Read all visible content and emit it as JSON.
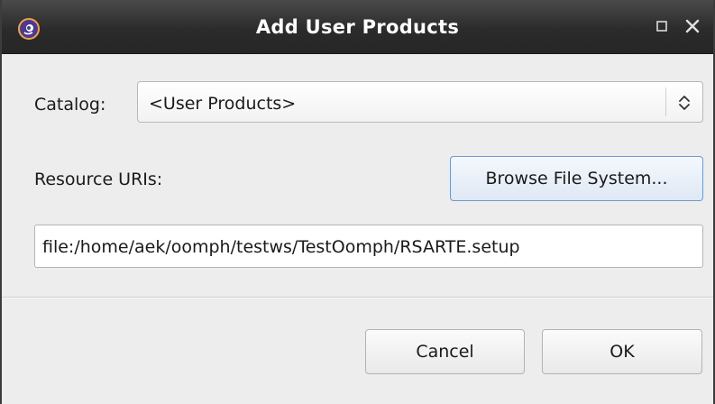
{
  "window": {
    "title": "Add User Products",
    "app_icon": "eclipse-oomph-icon",
    "controls": [
      "maximize-icon",
      "close-icon"
    ]
  },
  "form": {
    "catalog_label": "Catalog:",
    "catalog_value": "<User Products>",
    "resource_label": "Resource URIs:",
    "browse_label": "Browse File System...",
    "uri_value": "file:/home/aek/oomph/testws/TestOomph/RSARTE.setup"
  },
  "buttons": {
    "cancel": "Cancel",
    "ok": "OK"
  },
  "colors": {
    "titlebar": "#2b2b2b",
    "dialog_bg": "#ededed",
    "focus_border": "#6f9ad1"
  }
}
